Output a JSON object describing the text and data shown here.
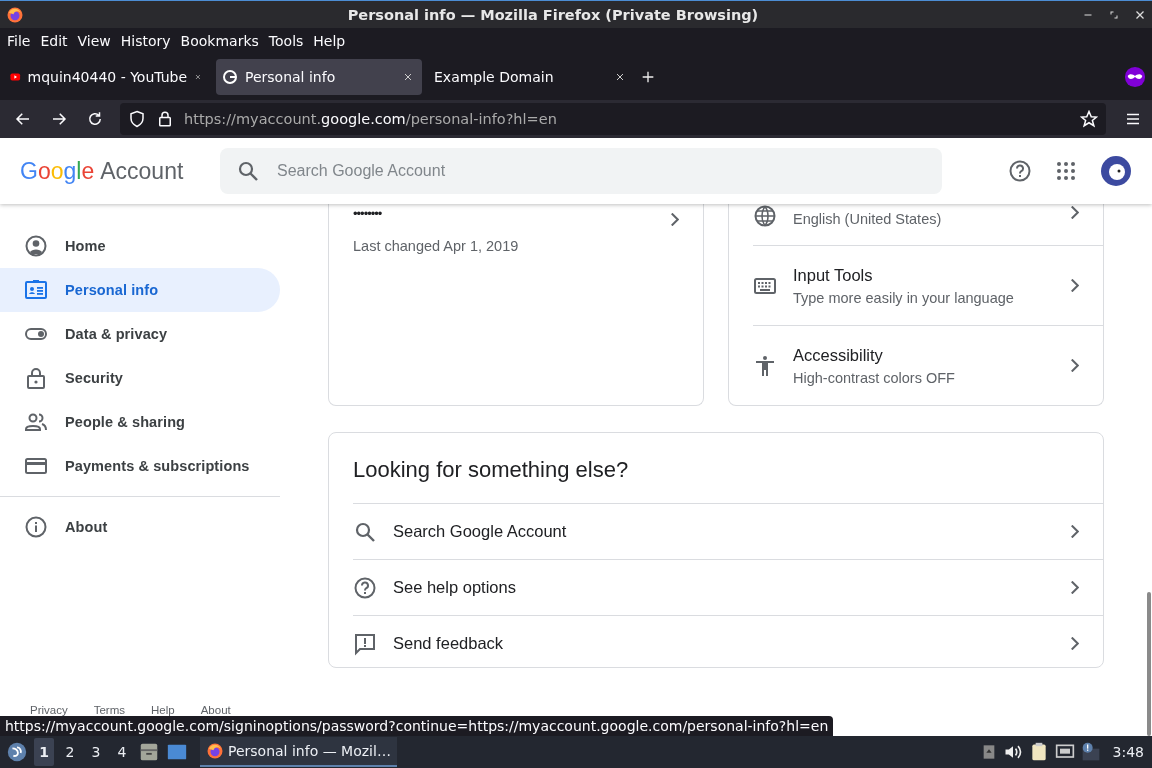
{
  "window": {
    "title": "Personal info — Mozilla Firefox (Private Browsing)"
  },
  "menu": [
    "File",
    "Edit",
    "View",
    "History",
    "Bookmarks",
    "Tools",
    "Help"
  ],
  "tabs": [
    {
      "label": "mquin40440 - YouTube",
      "selected": false,
      "kind": "youtube"
    },
    {
      "label": "Personal info",
      "selected": true,
      "kind": "google"
    },
    {
      "label": "Example Domain",
      "selected": false,
      "kind": "plain"
    }
  ],
  "address": {
    "prefix": "https://myaccount.",
    "domain": "google.com",
    "path": "/personal-info?hl=en"
  },
  "header": {
    "logo": "Google",
    "title": "Account",
    "search_placeholder": "Search Google Account"
  },
  "sidebar": {
    "items": [
      {
        "label": "Home",
        "selected": false
      },
      {
        "label": "Personal info",
        "selected": true
      },
      {
        "label": "Data & privacy",
        "selected": false
      },
      {
        "label": "Security",
        "selected": false
      },
      {
        "label": "People & sharing",
        "selected": false
      },
      {
        "label": "Payments & subscriptions",
        "selected": false
      }
    ],
    "footer_items": [
      {
        "label": "About",
        "selected": false
      }
    ]
  },
  "password_card": {
    "value": "••••••••",
    "detail": "Last changed Apr 1, 2019"
  },
  "preferences": [
    {
      "subtitle": "English (United States)"
    },
    {
      "title": "Input Tools",
      "subtitle": "Type more easily in your language"
    },
    {
      "title": "Accessibility",
      "subtitle": "High-contrast colors OFF"
    }
  ],
  "help_card": {
    "title": "Looking for something else?",
    "items": [
      {
        "label": "Search Google Account"
      },
      {
        "label": "See help options"
      },
      {
        "label": "Send feedback"
      }
    ]
  },
  "footer_links": [
    "Privacy",
    "Terms",
    "Help",
    "About"
  ],
  "status_url": "https://myaccount.google.com/signinoptions/password?continue=https://myaccount.google.com/personal-info?hl=en",
  "taskbar": {
    "workspaces": [
      {
        "label": "1",
        "selected": true
      },
      {
        "label": "2",
        "selected": false
      },
      {
        "label": "3",
        "selected": false
      },
      {
        "label": "4",
        "selected": false
      }
    ],
    "task": "Personal info — Mozil…",
    "clock": "3:48"
  }
}
